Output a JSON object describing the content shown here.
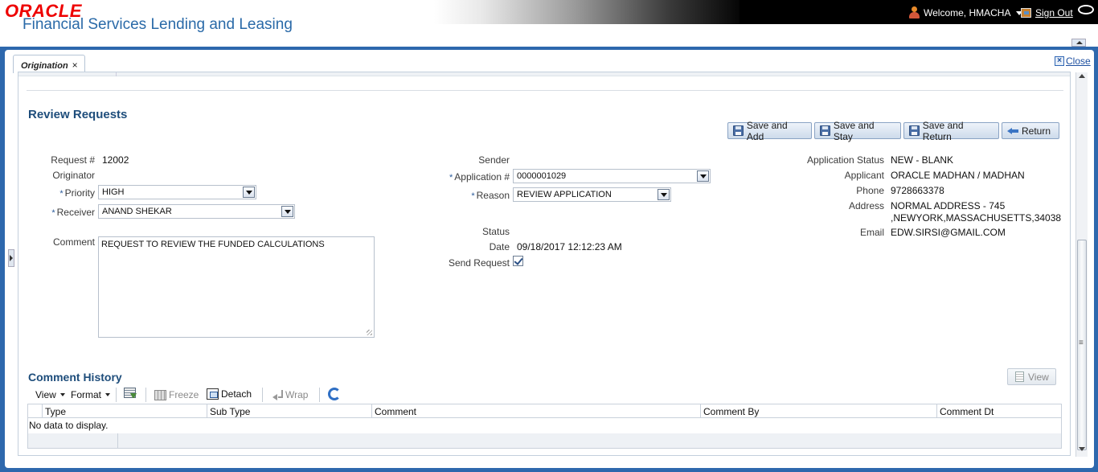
{
  "header": {
    "logo": "ORACLE",
    "product": "Financial Services Lending and Leasing",
    "welcome": "Welcome, HMACHA",
    "sign_out": "Sign Out"
  },
  "tabs": {
    "active": "Origination",
    "close_tab": "×",
    "close_label": "Close",
    "close_x": "×"
  },
  "review": {
    "title": "Review Requests",
    "buttons": {
      "save_add": "Save and Add",
      "save_stay": "Save and Stay",
      "save_return": "Save and Return",
      "return": "Return"
    },
    "left": {
      "request_label": "Request #",
      "request_value": "12002",
      "originator_label": "Originator",
      "priority_label": "Priority",
      "priority_value": "HIGH",
      "receiver_label": "Receiver",
      "receiver_value": "ANAND SHEKAR",
      "comment_label": "Comment",
      "comment_value": "REQUEST TO REVIEW THE FUNDED CALCULATIONS",
      "required_mark": "*"
    },
    "middle": {
      "sender_label": "Sender",
      "application_label": "Application #",
      "application_value": "0000001029",
      "reason_label": "Reason",
      "reason_value": "REVIEW APPLICATION",
      "status_label": "Status",
      "date_label": "Date",
      "date_value": "09/18/2017 12:12:23 AM",
      "send_request_label": "Send Request",
      "send_request_checked": true,
      "required_mark": "*"
    },
    "right": {
      "app_status_label": "Application Status",
      "app_status_value": "NEW - BLANK",
      "applicant_label": "Applicant",
      "applicant_value": "ORACLE MADHAN / MADHAN",
      "phone_label": "Phone",
      "phone_value": "9728663378",
      "address_label": "Address",
      "address_line1": "NORMAL ADDRESS - 745",
      "address_line2": ",NEWYORK,MASSACHUSETTS,34038",
      "email_label": "Email",
      "email_value": "EDW.SIRSI@GMAIL.COM"
    }
  },
  "comment_history": {
    "title": "Comment History",
    "view_button": "View",
    "toolbar": {
      "view": "View",
      "format": "Format",
      "freeze": "Freeze",
      "detach": "Detach",
      "wrap": "Wrap"
    },
    "columns": [
      "Type",
      "Sub Type",
      "Comment",
      "Comment By",
      "Comment Dt"
    ],
    "empty_text": "No data to display."
  },
  "colors": {
    "frame_blue": "#2e68ad",
    "title_blue": "#1e4d7b",
    "oracle_red": "#e00000"
  }
}
